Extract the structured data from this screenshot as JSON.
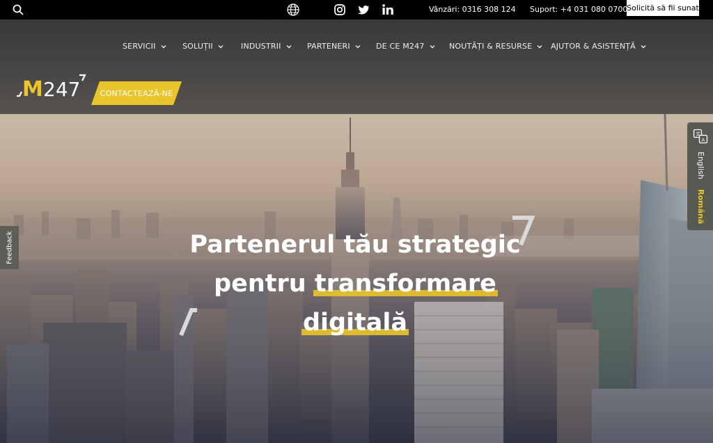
{
  "topbar": {
    "sales": "Vânzări: 0316 308 124",
    "support": "Suport: +4 031 080 0700",
    "callback_button": "Solicită să fii sunat"
  },
  "nav": {
    "items": [
      {
        "label": "SERVICII"
      },
      {
        "label": "SOLUȚII"
      },
      {
        "label": "INDUSTRII"
      },
      {
        "label": "PARTENERI"
      },
      {
        "label": "DE CE M247"
      },
      {
        "label": "NOUTĂȚI & RESURSE"
      },
      {
        "label": "AJUTOR & ASISTENȚĂ"
      }
    ],
    "cta": "CONTACTEAZĂ-NE"
  },
  "logo": {
    "text": "M247",
    "accent_color": "#e9c42b"
  },
  "hero": {
    "line1": "Partenerul tău strategic",
    "line2_plain": "pentru ",
    "line2_highlight": "transformare",
    "line3_highlight": "digitală"
  },
  "side": {
    "feedback": "Feedback",
    "lang_en": "English",
    "lang_ro": "Română"
  },
  "colors": {
    "accent": "#e9c42b",
    "topbar": "#000000"
  }
}
